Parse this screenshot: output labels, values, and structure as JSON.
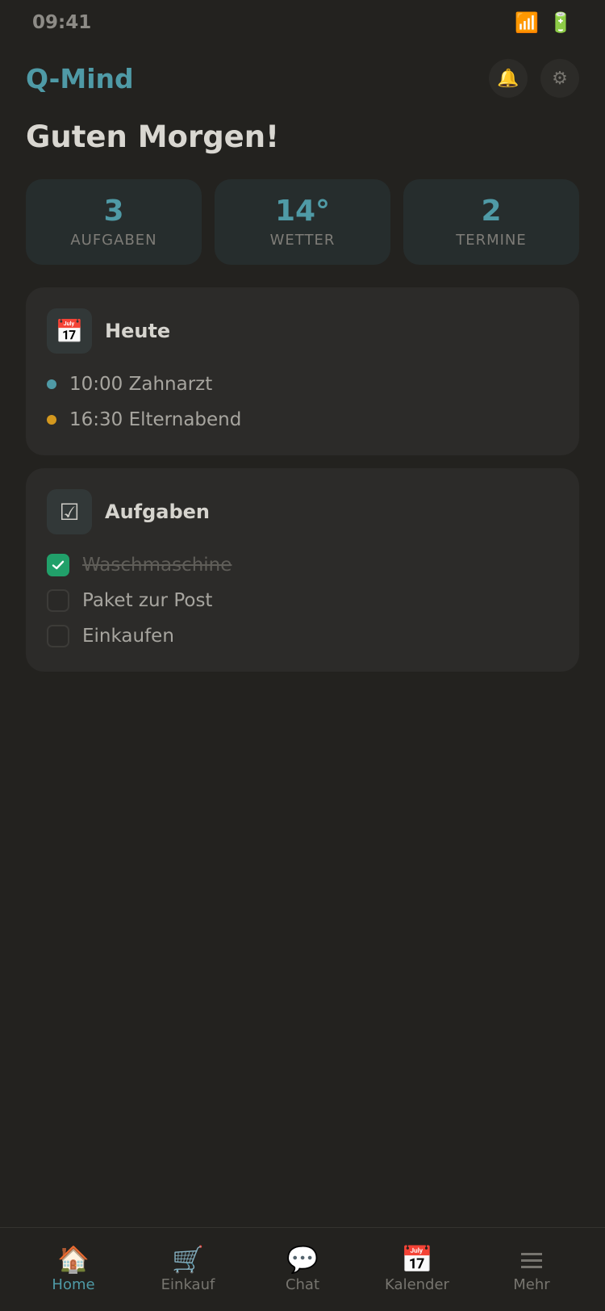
{
  "status": {
    "time": "09:41",
    "signal_icon": "📶",
    "battery_icon": "🔋"
  },
  "header": {
    "title": "Q-Mind",
    "bell_icon": "🔔",
    "settings_icon": "⚙"
  },
  "greeting": "Guten Morgen!",
  "stats": [
    {
      "value": "3",
      "label": "AUFGABEN"
    },
    {
      "value": "14°",
      "label": "WETTER"
    },
    {
      "value": "2",
      "label": "TERMINE"
    }
  ],
  "today": {
    "icon": "📅",
    "title": "Heute",
    "events": [
      {
        "label": "10:00 Zahnarzt",
        "color": "#4f9aa6"
      },
      {
        "label": "16:30 Elternabend",
        "color": "#d4981e"
      }
    ]
  },
  "tasks": {
    "icon": "☑",
    "title": "Aufgaben",
    "items": [
      {
        "label": "Waschmaschine",
        "done": true
      },
      {
        "label": "Paket zur Post",
        "done": false
      },
      {
        "label": "Einkaufen",
        "done": false
      }
    ]
  },
  "nav": [
    {
      "icon": "🏠",
      "label": "Home",
      "active": true
    },
    {
      "icon": "🛒",
      "label": "Einkauf",
      "active": false
    },
    {
      "icon": "💬",
      "label": "Chat",
      "active": false
    },
    {
      "icon": "📅",
      "label": "Kalender",
      "active": false
    },
    {
      "icon": "☰",
      "label": "Mehr",
      "active": false
    }
  ],
  "colors": {
    "accent": "#4f9aa6",
    "background": "#23221f",
    "card": "#2c2b29",
    "check": "#21a06a"
  }
}
